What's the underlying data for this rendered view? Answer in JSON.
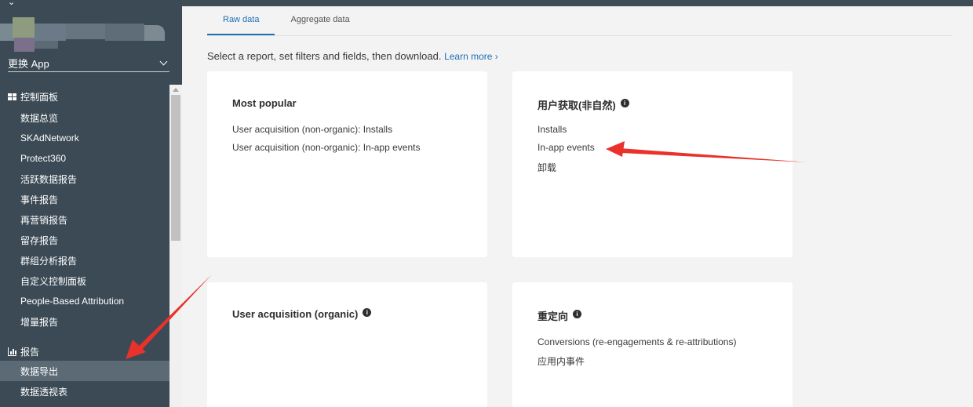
{
  "sidebar": {
    "app_switcher_label": "更换 App",
    "sections": [
      {
        "label": "控制面板",
        "icon": "dashboard-grid-icon"
      },
      {
        "label": "报告",
        "icon": "bar-chart-icon"
      }
    ],
    "dashboard_items": [
      "数据总览",
      "SKAdNetwork",
      "Protect360",
      "活跃数据报告",
      "事件报告",
      "再营销报告",
      "留存报告",
      "群组分析报告",
      "自定义控制面板",
      "People-Based Attribution",
      "增量报告"
    ],
    "report_items": [
      {
        "label": "数据导出",
        "active": true
      },
      {
        "label": "数据透视表",
        "active": false
      }
    ]
  },
  "tabs": [
    {
      "label": "Raw data",
      "active": true
    },
    {
      "label": "Aggregate data",
      "active": false
    }
  ],
  "intro": {
    "text": "Select a report, set filters and fields, then download.",
    "learn_more": "Learn more ›"
  },
  "cards": {
    "most_popular": {
      "title": "Most popular",
      "links": [
        "User acquisition (non-organic): Installs",
        "User acquisition (non-organic): In-app events"
      ]
    },
    "ua_non_organic": {
      "title": "用户获取(非自然)",
      "links": [
        "Installs",
        "In-app events",
        "卸载"
      ]
    },
    "ua_organic": {
      "title": "User acquisition (organic)",
      "links": []
    },
    "retargeting": {
      "title": "重定向",
      "links": [
        "Conversions (re-engagements & re-attributions)",
        "应用内事件"
      ]
    }
  },
  "colors": {
    "sidebar_bg": "#3b4a55",
    "sidebar_active": "#5b6a75",
    "accent": "#1f6fb6",
    "annotation_arrow": "#e8322b"
  }
}
